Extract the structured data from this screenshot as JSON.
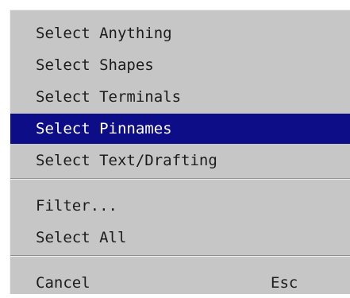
{
  "menu": {
    "items": [
      {
        "label": "Select Anything"
      },
      {
        "label": "Select Shapes"
      },
      {
        "label": "Select Terminals"
      },
      {
        "label": "Select Pinnames",
        "selected": true
      },
      {
        "label": "Select Text/Drafting"
      },
      {
        "label": "Filter..."
      },
      {
        "label": "Select All"
      },
      {
        "label": "Cancel",
        "shortcut": "Esc"
      }
    ],
    "colors": {
      "background": "#c6c6c6",
      "highlight": "#0d0d88",
      "highlight_text": "#ffffff",
      "text": "#1c1c1c"
    }
  }
}
